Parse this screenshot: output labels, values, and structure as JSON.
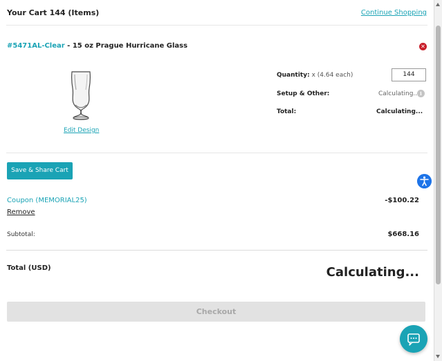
{
  "header": {
    "title": "Your Cart 144 (Items)",
    "continue_link": "Continue Shopping"
  },
  "item": {
    "sku": "#5471AL-Clear",
    "separator": " - ",
    "name": "15 oz Prague Hurricane Glass",
    "edit_design": "Edit Design",
    "quantity_label": "Quantity:",
    "quantity_each": " x (4.64 each)",
    "quantity_value": "144",
    "setup_label": "Setup & Other:",
    "setup_value": "Calculating..",
    "total_label": "Total:",
    "total_value": "Calculating..."
  },
  "actions": {
    "save_share": "Save & Share Cart"
  },
  "coupon": {
    "label": "Coupon (MEMORIAL25)",
    "amount": "-$100.22",
    "remove": "Remove"
  },
  "summary": {
    "subtotal_label": "Subtotal:",
    "subtotal_value": "$668.16",
    "total_label": "Total (USD)",
    "total_value": "Calculating..."
  },
  "checkout": {
    "label": "Checkout"
  },
  "icons": {
    "remove_item": "close-circle-icon",
    "info": "info-icon",
    "accessibility": "accessibility-icon",
    "chat": "chat-icon"
  },
  "colors": {
    "accent": "#1aa3b5",
    "remove_red": "#c81e2a",
    "accessibility_blue": "#1e74e8",
    "checkout_disabled_bg": "#e2e2e2"
  }
}
